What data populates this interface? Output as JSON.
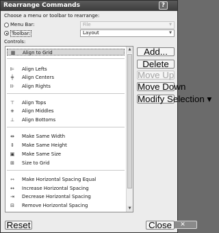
{
  "window": {
    "title": "Rearrange Commands"
  },
  "instructions": {
    "choose_label": "Choose a menu or toolbar to rearrange:"
  },
  "target": {
    "menu_bar": {
      "label": "Menu Bar:",
      "value": "File",
      "selected": false
    },
    "toolbar": {
      "label": "Toolbar:",
      "value": "Layout",
      "selected": true
    }
  },
  "controls": {
    "label": "Controls:",
    "items": [
      {
        "label": "Align to Grid",
        "icon": "grid-icon",
        "selected": true
      },
      {
        "label": "Align Lefts",
        "icon": "align-left-icon"
      },
      {
        "label": "Align Centers",
        "icon": "align-center-icon"
      },
      {
        "label": "Align Rights",
        "icon": "align-right-icon"
      },
      {
        "label": "Align Tops",
        "icon": "align-top-icon"
      },
      {
        "label": "Align Middles",
        "icon": "align-middle-icon"
      },
      {
        "label": "Align Bottoms",
        "icon": "align-bottom-icon"
      },
      {
        "label": "Make Same Width",
        "icon": "same-width-icon"
      },
      {
        "label": "Make Same Height",
        "icon": "same-height-icon"
      },
      {
        "label": "Make Same Size",
        "icon": "same-size-icon"
      },
      {
        "label": "Size to Grid",
        "icon": "size-to-grid-icon"
      },
      {
        "label": "Make Horizontal Spacing Equal",
        "icon": "horizontal-spacing-equal-icon"
      },
      {
        "label": "Increase Horizontal Spacing",
        "icon": "increase-horizontal-spacing-icon"
      },
      {
        "label": "Decrease Horizontal Spacing",
        "icon": "decrease-horizontal-spacing-icon"
      },
      {
        "label": "Remove Horizontal Spacing",
        "icon": "remove-horizontal-spacing-icon"
      }
    ]
  },
  "buttons": {
    "add": "Add...",
    "delete": "Delete",
    "move_up": "Move Up",
    "move_down": "Move Down",
    "modify_selection": "Modify Selection ▾",
    "reset": "Reset",
    "close": "Close"
  }
}
